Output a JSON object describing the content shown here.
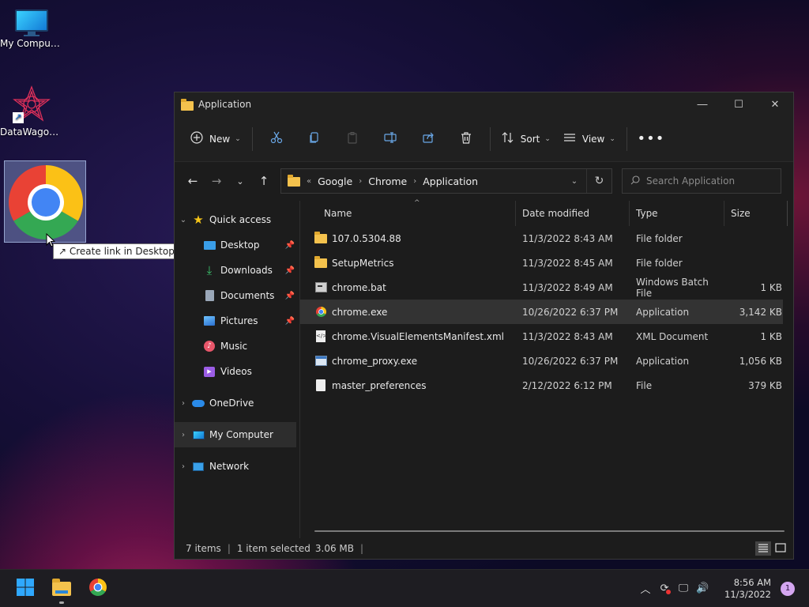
{
  "desktop": {
    "icons": [
      {
        "label": "My Computer"
      },
      {
        "label": "DataWagon..."
      }
    ],
    "tooltip": "Create link in Desktop"
  },
  "window": {
    "title": "Application",
    "commands": {
      "new_label": "New",
      "sort_label": "Sort",
      "view_label": "View"
    },
    "address": {
      "crumbs": [
        "Google",
        "Chrome",
        "Application"
      ]
    },
    "search": {
      "placeholder": "Search Application"
    },
    "sidebar": {
      "quick_access": "Quick access",
      "items": [
        {
          "label": "Desktop",
          "icon": "desktop-icon",
          "color": "#3a9ee8"
        },
        {
          "label": "Downloads",
          "icon": "download-icon",
          "color": "#3cc46d"
        },
        {
          "label": "Documents",
          "icon": "document-icon",
          "color": "#9aa7b8"
        },
        {
          "label": "Pictures",
          "icon": "pictures-icon",
          "color": "#3a8ee6"
        },
        {
          "label": "Music",
          "icon": "music-icon",
          "color": "#e8566a"
        },
        {
          "label": "Videos",
          "icon": "videos-icon",
          "color": "#9b5de5"
        }
      ],
      "onedrive": "OneDrive",
      "my_computer": "My Computer",
      "network": "Network"
    },
    "columns": {
      "name": "Name",
      "date": "Date modified",
      "type": "Type",
      "size": "Size"
    },
    "files": [
      {
        "name": "107.0.5304.88",
        "date": "11/3/2022 8:43 AM",
        "type": "File folder",
        "size": "",
        "icon": "folder-icon"
      },
      {
        "name": "SetupMetrics",
        "date": "11/3/2022 8:45 AM",
        "type": "File folder",
        "size": "",
        "icon": "folder-icon"
      },
      {
        "name": "chrome.bat",
        "date": "11/3/2022 8:49 AM",
        "type": "Windows Batch File",
        "size": "1 KB",
        "icon": "batch-file-icon"
      },
      {
        "name": "chrome.exe",
        "date": "10/26/2022 6:37 PM",
        "type": "Application",
        "size": "3,142 KB",
        "icon": "chrome-icon",
        "selected": true
      },
      {
        "name": "chrome.VisualElementsManifest.xml",
        "date": "11/3/2022 8:43 AM",
        "type": "XML Document",
        "size": "1 KB",
        "icon": "xml-file-icon"
      },
      {
        "name": "chrome_proxy.exe",
        "date": "10/26/2022 6:37 PM",
        "type": "Application",
        "size": "1,056 KB",
        "icon": "application-icon"
      },
      {
        "name": "master_preferences",
        "date": "2/12/2022 6:12 PM",
        "type": "File",
        "size": "379 KB",
        "icon": "file-icon"
      }
    ],
    "status": {
      "items": "7 items",
      "selected": "1 item selected",
      "size": "3.06 MB"
    }
  },
  "taskbar": {
    "time": "8:56 AM",
    "date": "11/3/2022",
    "notifications": "1"
  }
}
